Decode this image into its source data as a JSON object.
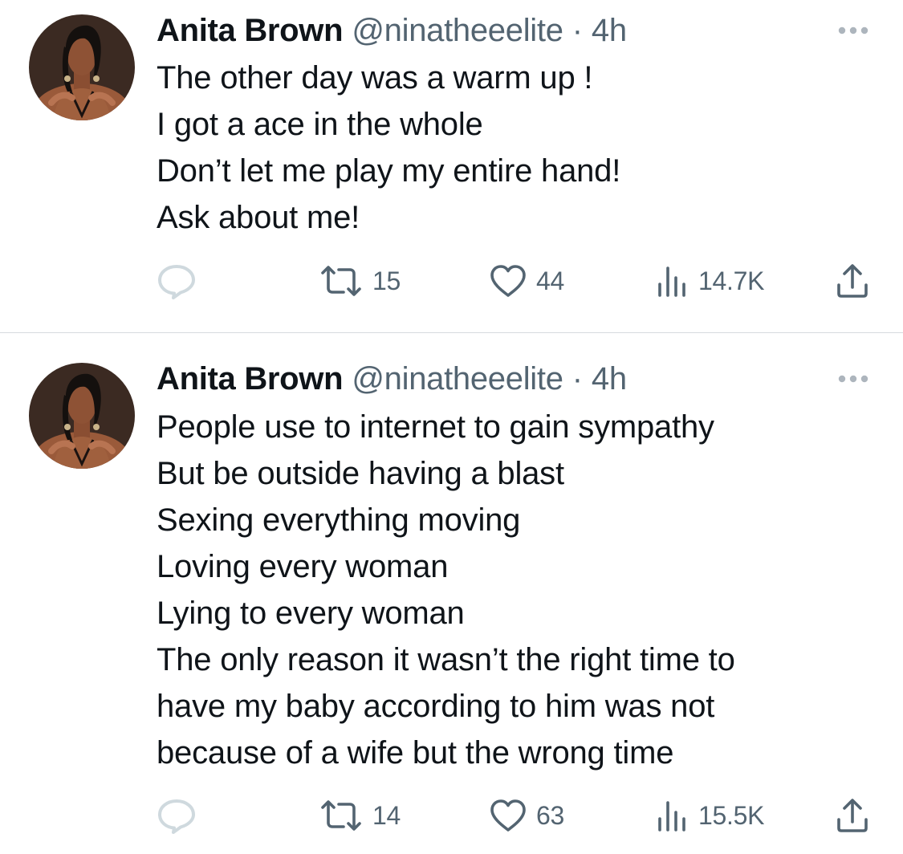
{
  "tweets": [
    {
      "author_name": "Anita Brown",
      "handle": "@ninatheeelite",
      "separator": "·",
      "time": "4h",
      "text_lines": [
        "The other day was a warm up !",
        "I got a ace in the whole",
        "Don’t let me play my entire hand!",
        "Ask about me!"
      ],
      "icons": {
        "reply": "reply-icon",
        "retweet": "retweet-icon",
        "like": "heart-icon",
        "views": "views-icon",
        "share": "share-icon",
        "more": "more-icon"
      },
      "reply_count": "",
      "retweets": "15",
      "likes": "44",
      "views": "14.7K"
    },
    {
      "author_name": "Anita Brown",
      "handle": "@ninatheeelite",
      "separator": "·",
      "time": "4h",
      "text_lines": [
        "People use to internet to gain sympathy",
        "But be outside having a blast",
        "Sexing everything moving",
        "Loving every woman",
        "Lying to every woman",
        "The only reason it wasn’t the right time to",
        "have my baby according to him was not",
        "because of a wife but the wrong time"
      ],
      "icons": {
        "reply": "reply-icon",
        "retweet": "retweet-icon",
        "like": "heart-icon",
        "views": "views-icon",
        "share": "share-icon",
        "more": "more-icon"
      },
      "reply_count": "",
      "retweets": "14",
      "likes": "63",
      "views": "15.5K"
    }
  ],
  "colors": {
    "text_primary": "#0f1419",
    "text_secondary": "#536471",
    "reply_icon": "#cfd9de",
    "divider": "#d7dbdf",
    "background": "#ffffff"
  }
}
